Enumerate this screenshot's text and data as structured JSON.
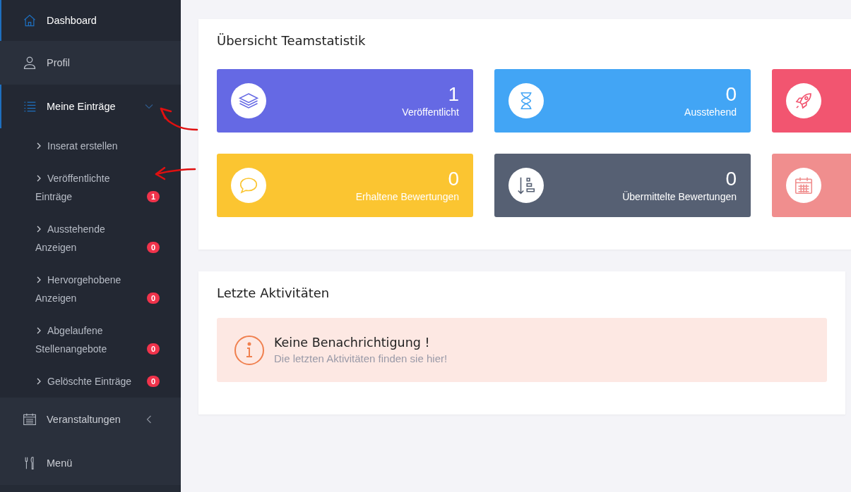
{
  "sidebar": {
    "items": [
      {
        "label": "Dashboard",
        "selected": true
      },
      {
        "label": "Profil",
        "selected": false
      },
      {
        "label": "Meine Einträge",
        "selected": true,
        "expanded": true,
        "children": [
          {
            "label": "Inserat erstellen"
          },
          {
            "label": "Veröffentlichte Einträge",
            "badge": "1"
          },
          {
            "label": "Ausstehende Anzeigen",
            "badge": "0"
          },
          {
            "label": "Hervorgehobene Anzeigen",
            "badge": "0"
          },
          {
            "label": "Abgelaufene Stellenangebote",
            "badge": "0"
          },
          {
            "label": "Gelöschte Einträge",
            "badge": "0"
          }
        ]
      },
      {
        "label": "Veranstaltungen",
        "selected": false,
        "expanded": false
      },
      {
        "label": "Menü",
        "selected": false
      }
    ]
  },
  "stats": {
    "title": "Übersicht Teamstatistik",
    "tiles": [
      {
        "value": "1",
        "label": "Veröffentlicht",
        "color": "#6569e4"
      },
      {
        "value": "0",
        "label": "Ausstehend",
        "color": "#42a5f5"
      },
      {
        "color": "#f25570"
      },
      {
        "value": "0",
        "label": "Erhaltene Bewertungen",
        "color": "#fbc531"
      },
      {
        "value": "0",
        "label": "Übermittelte Bewertungen",
        "color": "#566073"
      },
      {
        "color": "#f08e8e"
      }
    ]
  },
  "activities": {
    "title": "Letzte Aktivitäten",
    "alert": {
      "title": "Keine Benachrichtigung !",
      "text": "Die letzten Aktivitäten finden sie hier!"
    }
  }
}
